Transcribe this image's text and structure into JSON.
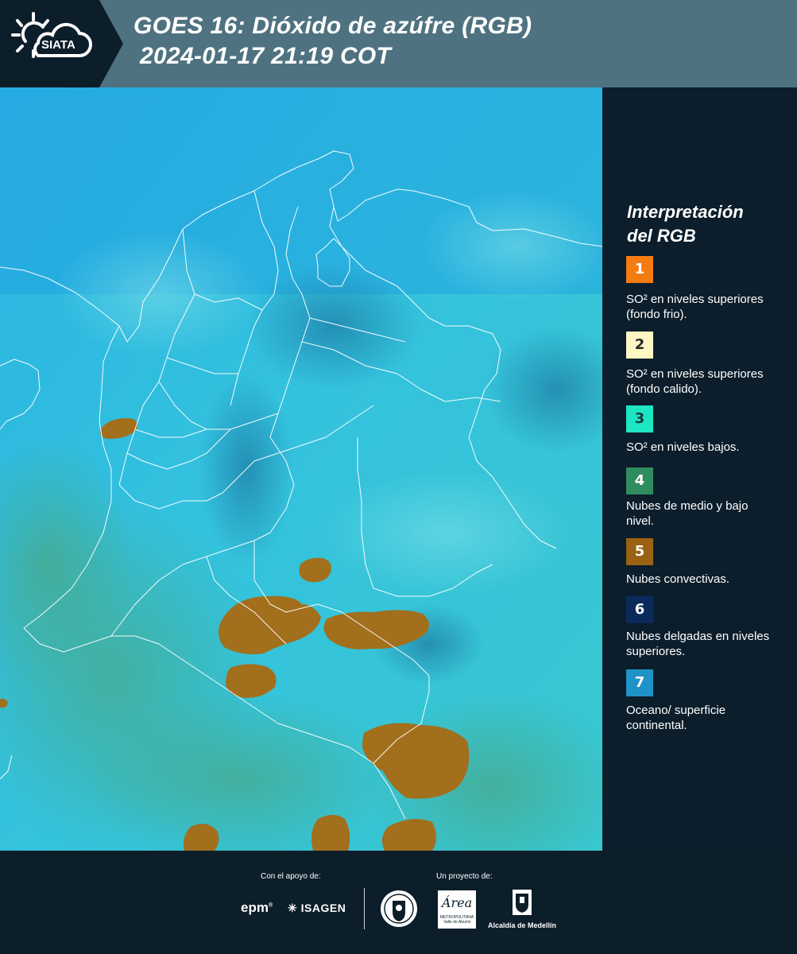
{
  "header": {
    "logo_text": "SIATA",
    "title_line1": "GOES 16: Dióxido de azúfre (RGB)",
    "title_line2": "2024-01-17 21:19 COT"
  },
  "legend": {
    "title_line1": "Interpretación",
    "title_line2": "del RGB",
    "items": [
      {
        "num": "1",
        "color": "#f57c12",
        "text_color": "#ffffff",
        "label": "SO² en niveles superiores (fondo frio)."
      },
      {
        "num": "2",
        "color": "#fff6c4",
        "text_color": "#2a2a2a",
        "label": "SO² en niveles superiores (fondo calido)."
      },
      {
        "num": "3",
        "color": "#1de6c3",
        "text_color": "#1a3a3a",
        "label": "SO² en niveles bajos."
      },
      {
        "num": "4",
        "color": "#2f8c5f",
        "text_color": "#ffffff",
        "label": "Nubes de medio y bajo nivel."
      },
      {
        "num": "5",
        "color": "#9a6212",
        "text_color": "#ffffff",
        "label": "Nubes convectivas."
      },
      {
        "num": "6",
        "color": "#0b2a5c",
        "text_color": "#ffffff",
        "label": "Nubes delgadas en niveles superiores."
      },
      {
        "num": "7",
        "color": "#1f93c7",
        "text_color": "#ffffff",
        "label": "Oceano/ superficie continental."
      }
    ]
  },
  "footer": {
    "support_label": "Con el apoyo de:",
    "project_label": "Un proyecto de:",
    "epm": "epm",
    "isagen": "ISAGEN",
    "area_metro": "Área",
    "area_metro_sub1": "METROPOLITANA",
    "area_metro_sub2": "Valle de Aburrá",
    "alcaldia": "Alcaldía de Medellín"
  }
}
